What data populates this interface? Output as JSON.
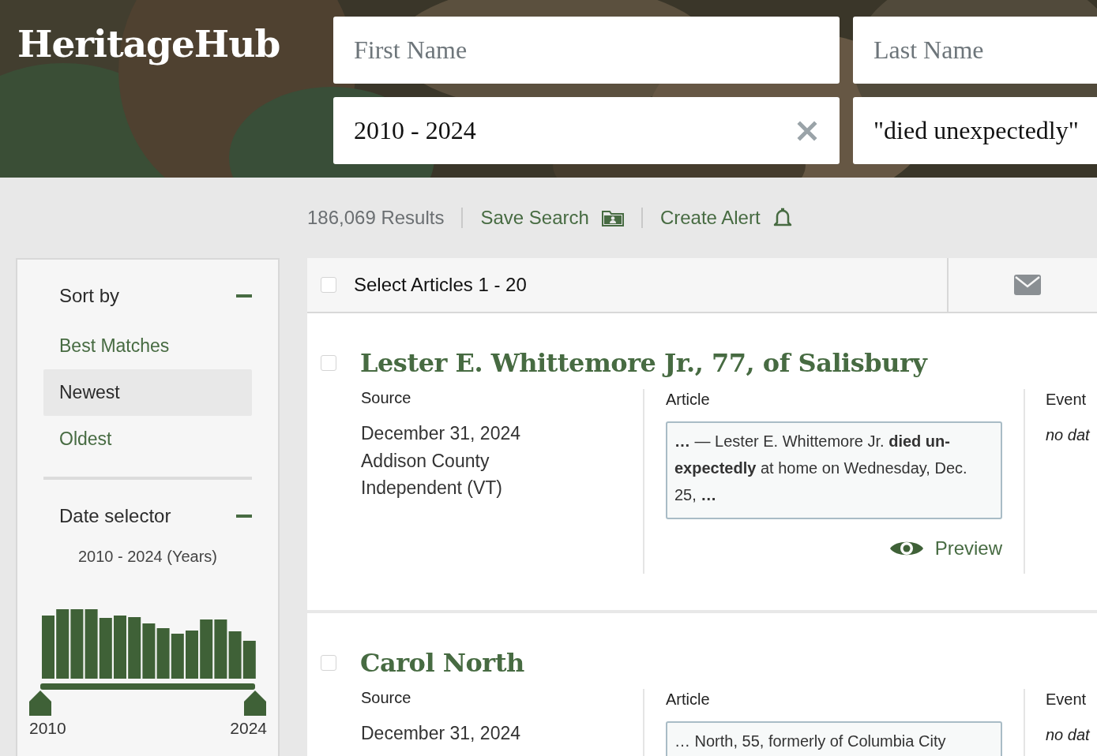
{
  "site": {
    "logo": "HeritageHub"
  },
  "search": {
    "fields": [
      {
        "kind": "text",
        "placeholder": "First Name"
      },
      {
        "kind": "text",
        "placeholder": "Last Name"
      },
      {
        "kind": "text",
        "value": "2010 - 2024",
        "clearable": true
      },
      {
        "kind": "text",
        "value": "\"died unexpectedly\""
      }
    ]
  },
  "toolbar": {
    "results": "186,069 Results",
    "actions": [
      {
        "kind": "save",
        "label": "Save Search"
      },
      {
        "kind": "alert",
        "label": "Create Alert"
      }
    ]
  },
  "sidebar": {
    "sections": [
      {
        "kind": "sort",
        "title": "Sort by",
        "expanded": true,
        "options": [
          {
            "label": "Best Matches",
            "selected": false
          },
          {
            "label": "Newest",
            "selected": true
          },
          {
            "label": "Oldest",
            "selected": false
          }
        ]
      },
      {
        "kind": "date",
        "title": "Date selector",
        "expanded": true,
        "range_label": "2010 - 2024 (Years)",
        "handles": [
          {
            "level": 0
          },
          {
            "level": 1
          }
        ],
        "start_label": "2010",
        "end_label": "2024"
      }
    ]
  },
  "results": {
    "select_all": {
      "label": "Select Articles 1 - 20",
      "checked": false
    },
    "items": [
      {
        "title": "Lester E. Whittemore Jr., 77, of Salisbury",
        "checked": false,
        "source_heading": "Source",
        "date": "December 31, 2024",
        "publication": "Addison County Independent (VT)",
        "article_heading": "Article",
        "snippet": "**…** — Lester E. Whittemore Jr. **died un-expectedly** at home on Wednesday, Dec. 25, **…**",
        "preview": "Preview",
        "event_heading": "Event",
        "event": "no dat"
      },
      {
        "title": "Carol North",
        "checked": false,
        "source_heading": "Source",
        "date": "December 31, 2024",
        "article_heading": "Article",
        "snippet": "… North, 55, formerly of Columbia City",
        "event_heading": "Event",
        "event": "no dat"
      }
    ]
  }
}
